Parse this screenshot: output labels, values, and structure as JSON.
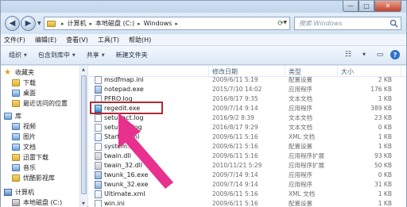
{
  "window": {
    "minimize_glyph": "—",
    "maximize_glyph": "□",
    "close_glyph": "✕"
  },
  "address": {
    "crumbs": [
      "计算机",
      "本地磁盘 (C:)",
      "Windows"
    ],
    "search_placeholder": "搜索 Windows"
  },
  "menu": [
    "文件(F)",
    "编辑(E)",
    "查看(V)",
    "工具(T)",
    "帮助(H)"
  ],
  "toolbar": {
    "organize": "组织",
    "include_in_library": "包含到库中",
    "share": "共享",
    "new_folder": "新建文件夹"
  },
  "nav": {
    "items": [
      {
        "label": "收藏夹",
        "icon": "star-icon"
      },
      {
        "label": "下载",
        "icon": "folder-icon"
      },
      {
        "label": "桌面",
        "icon": "desktop-icon"
      },
      {
        "label": "最近访问的位置",
        "icon": "recent-icon"
      },
      {
        "label": "库",
        "icon": "library-icon"
      },
      {
        "label": "视频",
        "icon": "video-icon"
      },
      {
        "label": "图片",
        "icon": "pictures-icon"
      },
      {
        "label": "文档",
        "icon": "documents-icon"
      },
      {
        "label": "迅雷下载",
        "icon": "folder-icon"
      },
      {
        "label": "音乐",
        "icon": "music-icon"
      },
      {
        "label": "优酷影视库",
        "icon": "folder-icon"
      },
      {
        "label": "计算机",
        "icon": "computer-icon"
      },
      {
        "label": "本地磁盘 (C:)",
        "icon": "drive-icon"
      }
    ]
  },
  "columns": {
    "name": "",
    "date": "修改日期",
    "type": "类型",
    "size": "大小"
  },
  "files": [
    {
      "name": "msdfmap.ini",
      "date": "2009/6/11 5:19",
      "type": "配置设置",
      "size": "2 KB",
      "icon": "ini"
    },
    {
      "name": "notepad.exe",
      "date": "2015/7/10 14:02",
      "type": "应用程序",
      "size": "176 KB",
      "icon": "exe"
    },
    {
      "name": "PFRO.log",
      "date": "2016/8/17 9:35",
      "type": "文本文档",
      "size": "1 KB",
      "icon": "log"
    },
    {
      "name": "regedit.exe",
      "date": "2009/7/14 9:14",
      "type": "应用程序",
      "size": "389 KB",
      "icon": "reg"
    },
    {
      "name": "setupact.log",
      "date": "2016/9/2 8:39",
      "type": "文本文档",
      "size": "23 KB",
      "icon": "log"
    },
    {
      "name": "setuperr.log",
      "date": "2016/8/17 9:29",
      "type": "文本文档",
      "size": "0 KB",
      "icon": "log"
    },
    {
      "name": "Starter.xml",
      "date": "2009/6/11 5:16",
      "type": "XML 文档",
      "size": "1 KB",
      "icon": "xml"
    },
    {
      "name": "system.ini",
      "date": "2009/6/11 5:16",
      "type": "配置设置",
      "size": "1 KB",
      "icon": "ini"
    },
    {
      "name": "twain.dll",
      "date": "2009/6/11 5:16",
      "type": "应用程序扩展",
      "size": "93 KB",
      "icon": "dll"
    },
    {
      "name": "twain_32.dll",
      "date": "2010/11/21 5:29",
      "type": "应用程序扩展",
      "size": "50 KB",
      "icon": "dll"
    },
    {
      "name": "twunk_16.exe",
      "date": "2009/7/14 9:14",
      "type": "应用程序",
      "size": "0 KB",
      "icon": "exe"
    },
    {
      "name": "twunk_32.exe",
      "date": "2009/7/14 9:14",
      "type": "应用程序",
      "size": "31 KB",
      "icon": "exe"
    },
    {
      "name": "Ultimate.xml",
      "date": "2009/6/11 5:16",
      "type": "XML 文档",
      "size": "1 KB",
      "icon": "xml"
    },
    {
      "name": "win.ini",
      "date": "2009/6/11 5:16",
      "type": "配置设置",
      "size": "1 KB",
      "icon": "ini"
    }
  ],
  "annotation": {
    "box_color": "#b22a32",
    "arrow_color": "#e8318f"
  }
}
